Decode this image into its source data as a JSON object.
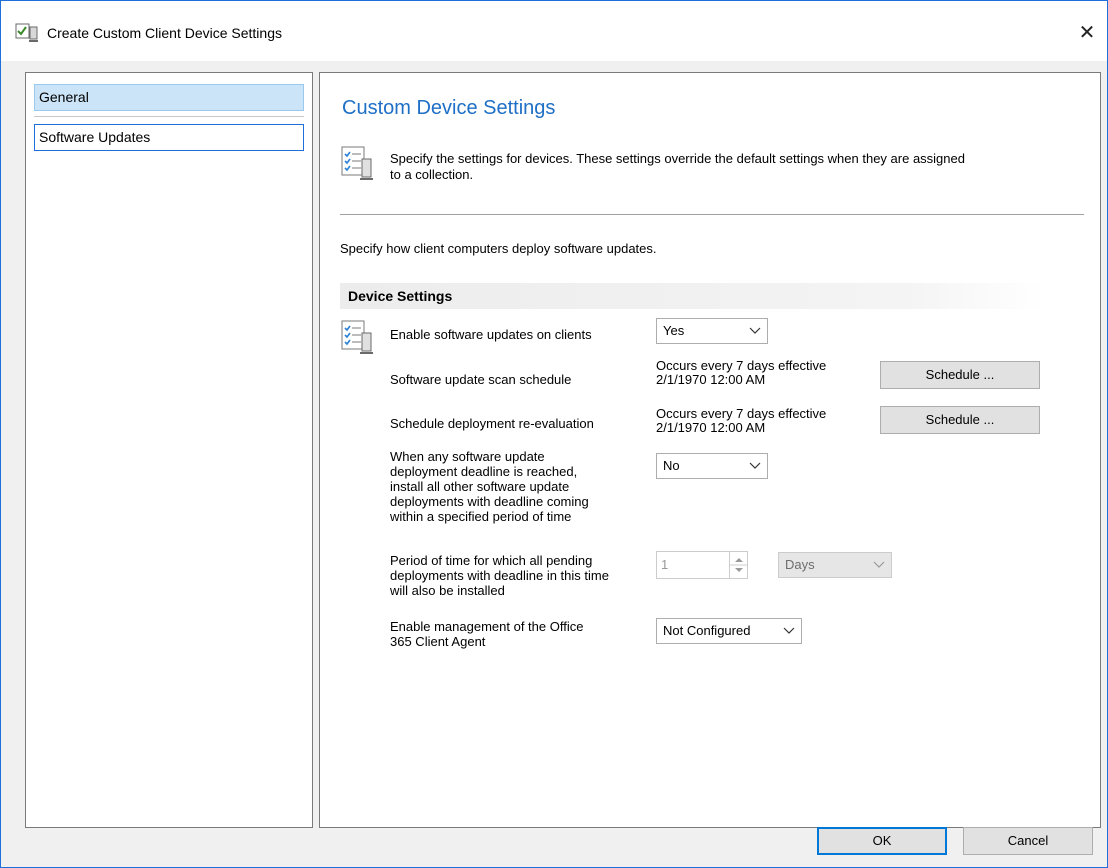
{
  "window": {
    "title": "Create Custom Client Device Settings",
    "close_glyph": "✕"
  },
  "nav": {
    "items": [
      {
        "label": "General",
        "selected": true
      },
      {
        "label": "Software Updates",
        "selected": false
      }
    ]
  },
  "main": {
    "heading": "Custom Device Settings",
    "intro_line1": "Specify the settings for devices. These settings override the default settings when they are assigned",
    "intro_line2": "to a collection.",
    "description": "Specify how client computers deploy software updates.",
    "section_header": "Device Settings",
    "settings": {
      "enable_updates": {
        "label": "Enable software updates on clients",
        "value": "Yes"
      },
      "scan_schedule": {
        "label": "Software update scan schedule",
        "value_line1": "Occurs every 7 days effective",
        "value_line2": "2/1/1970 12:00 AM",
        "button": "Schedule ..."
      },
      "reevaluation": {
        "label": "Schedule deployment re-evaluation",
        "value_line1": "Occurs every 7 days effective",
        "value_line2": "2/1/1970 12:00 AM",
        "button": "Schedule ..."
      },
      "deadline": {
        "label_lines": [
          "When any software update",
          "deployment deadline is reached,",
          "install all other software update",
          "deployments with deadline coming",
          "within a specified period of time"
        ],
        "value": "No"
      },
      "period": {
        "label_lines": [
          "Period of time for which all pending",
          "deployments with deadline in this time",
          "will also be installed"
        ],
        "number": "1",
        "unit": "Days"
      },
      "office365": {
        "label_lines": [
          "Enable management of the Office",
          "365 Client Agent"
        ],
        "value": "Not Configured"
      }
    }
  },
  "footer": {
    "ok_label": "OK",
    "cancel_label": "Cancel"
  },
  "colors": {
    "accent": "#0078d7",
    "heading": "#1e6fc6",
    "selected_bg": "#cce4f7"
  }
}
